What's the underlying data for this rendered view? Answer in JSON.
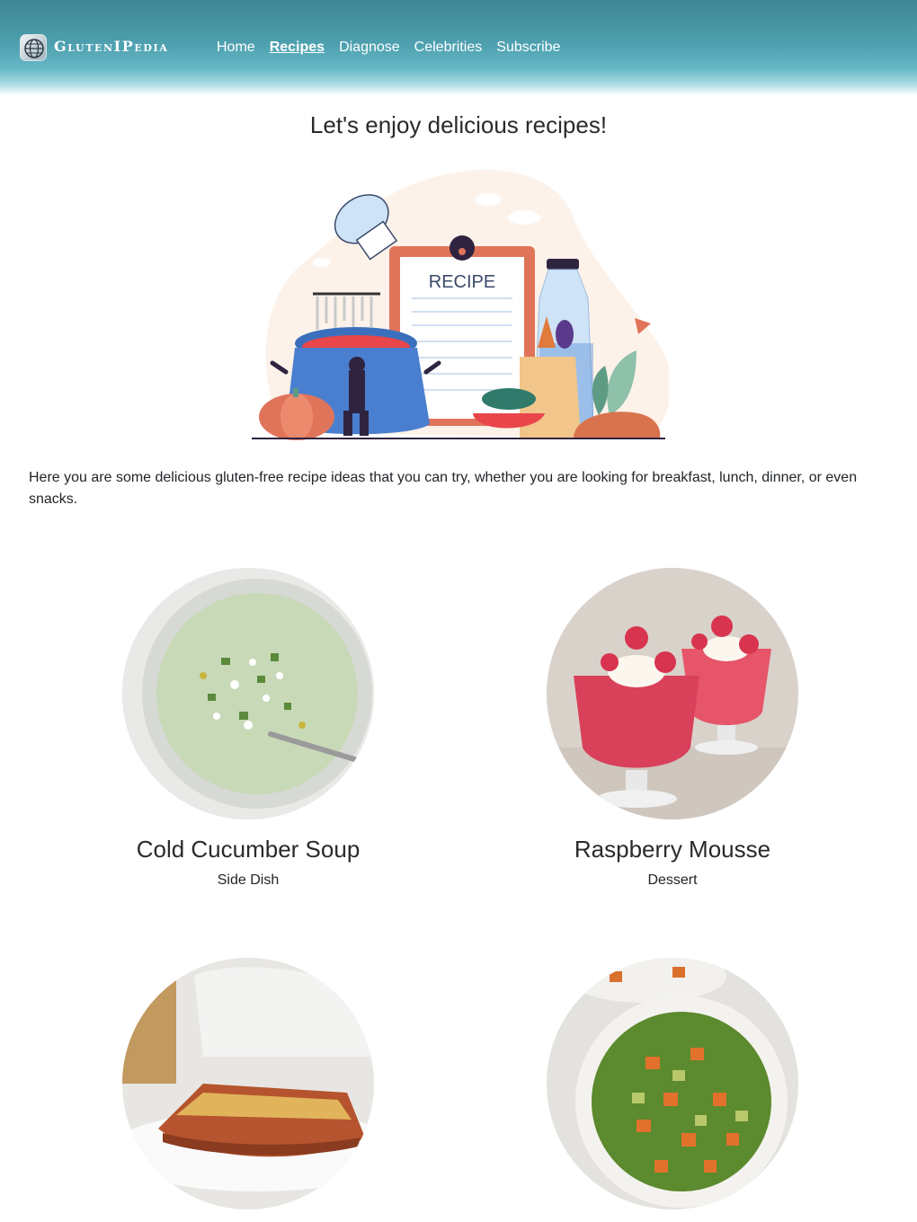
{
  "header": {
    "brand": "GlutenIPedia",
    "nav": [
      {
        "label": "Home",
        "active": false
      },
      {
        "label": "Recipes",
        "active": true
      },
      {
        "label": "Diagnose",
        "active": false
      },
      {
        "label": "Celebrities",
        "active": false
      },
      {
        "label": "Subscribe",
        "active": false
      }
    ],
    "colors": {
      "header_top": "#3f8796",
      "header_bottom": "#ffffff"
    }
  },
  "main": {
    "title": "Let's enjoy delicious recipes!",
    "hero_label": "RECIPE",
    "intro": "Here you are some delicious gluten-free recipe ideas that you can try, whether you are looking for breakfast, lunch, dinner, or even snacks.",
    "recipes": [
      {
        "name": "Cold Cucumber Soup",
        "category": "Side Dish",
        "icon": "cucumber-soup-photo"
      },
      {
        "name": "Raspberry Mousse",
        "category": "Dessert",
        "icon": "raspberry-mousse-photo"
      },
      {
        "name": "",
        "category": "",
        "icon": "lasagna-photo"
      },
      {
        "name": "",
        "category": "",
        "icon": "sweet-potato-salad-photo"
      }
    ]
  }
}
